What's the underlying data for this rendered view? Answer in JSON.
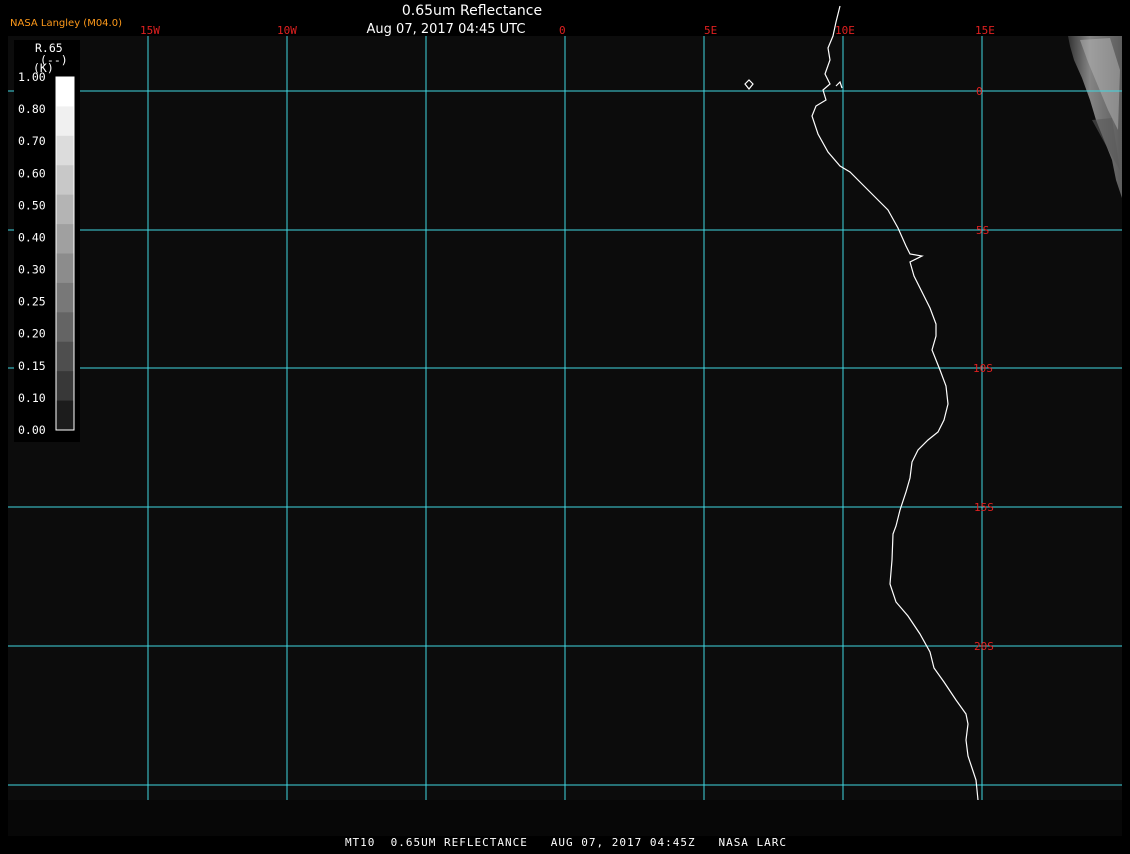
{
  "header": {
    "credit": "NASA Langley (M04.0)",
    "title": "0.65um Reflectance",
    "timestamp": "Aug 07, 2017 04:45 UTC"
  },
  "longitude_labels": [
    "15W",
    "10W",
    "0",
    "5E",
    "10E",
    "15E"
  ],
  "latitude_labels": [
    "0",
    "5S",
    "10S",
    "15S",
    "20S"
  ],
  "legend": {
    "variable": "R.65",
    "units_line1": "(--)",
    "units_line2": "(K)",
    "ticks": [
      "1.00",
      "0.80",
      "0.70",
      "0.60",
      "0.50",
      "0.40",
      "0.30",
      "0.25",
      "0.20",
      "0.15",
      "0.10",
      "0.00"
    ],
    "ramp_colors": [
      "#ffffff",
      "#f0f0f0",
      "#dcdcdc",
      "#c8c8c8",
      "#b4b4b4",
      "#a0a0a0",
      "#8c8c8c",
      "#787878",
      "#646464",
      "#4e4e4e",
      "#383838",
      "#1c1c1c"
    ]
  },
  "footer": {
    "text": "MT10  0.65UM REFLECTANCE   AUG 07, 2017 04:45Z   NASA LARC"
  },
  "colors": {
    "background": "#0c0c0c",
    "gridlines": "#3fd6e0",
    "grid_labels": "#e02020",
    "coastline": "#ffffff",
    "credit": "#ff9a1a"
  }
}
